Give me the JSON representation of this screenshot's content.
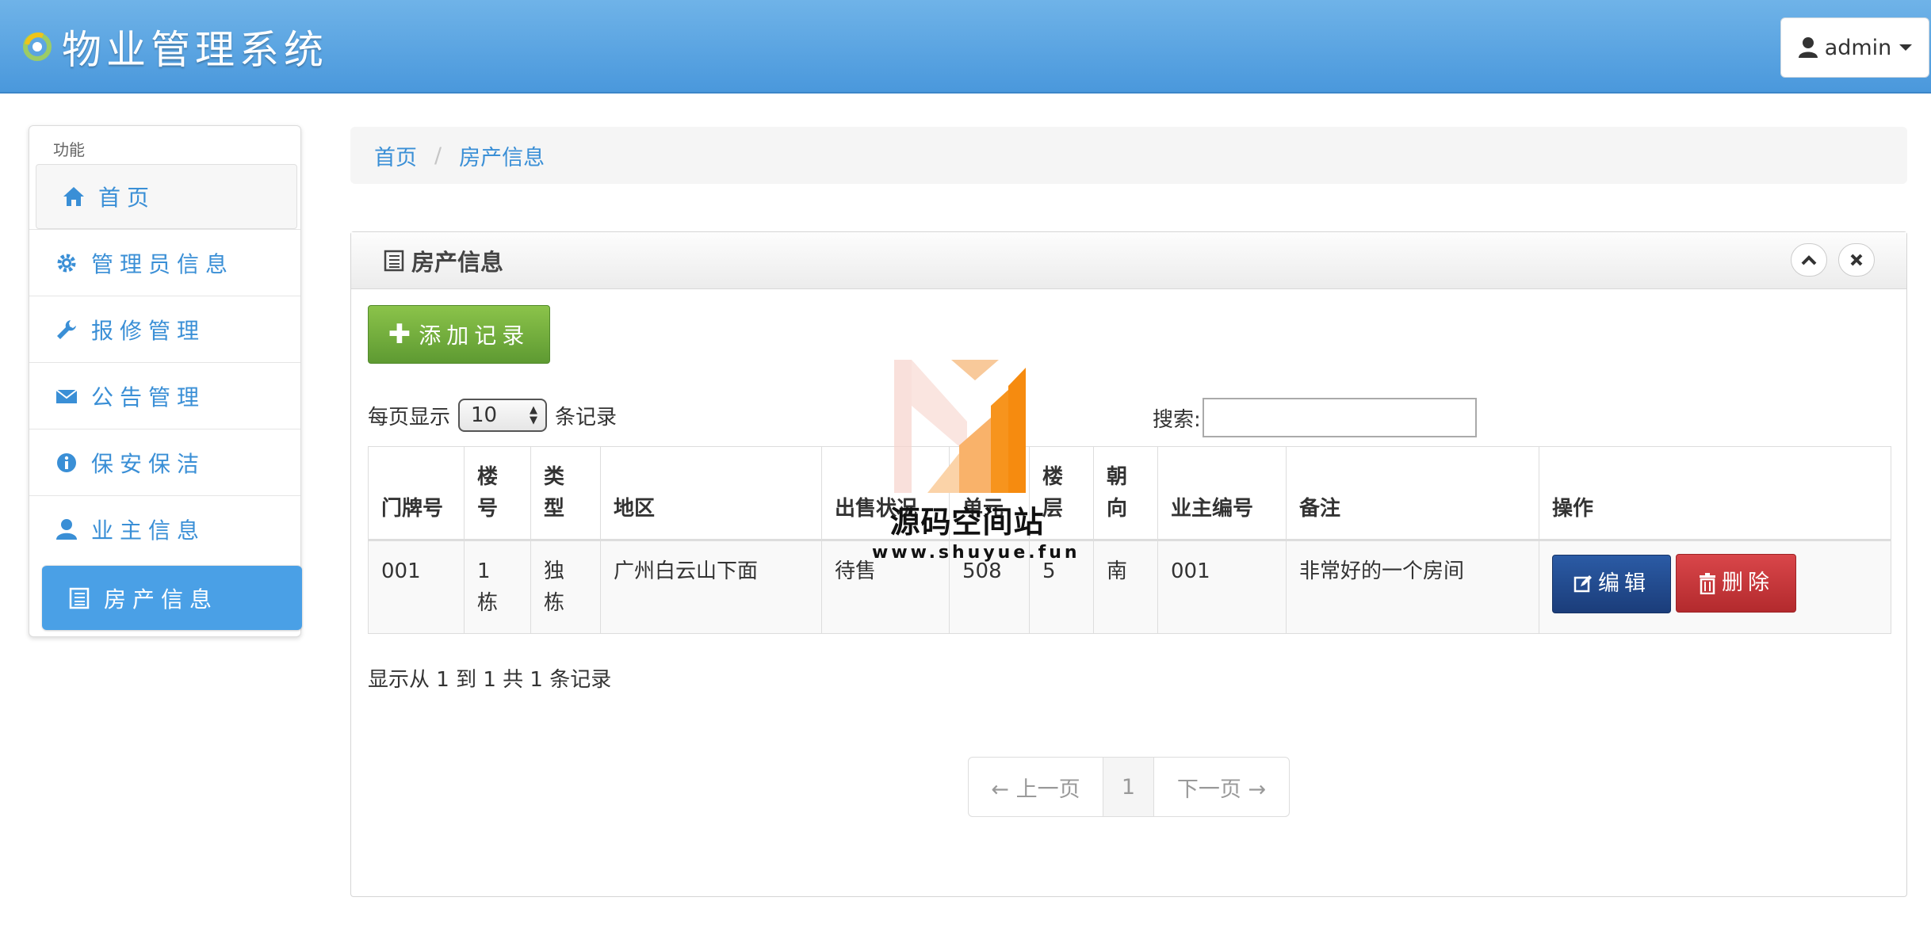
{
  "app": {
    "title": "物业管理系统",
    "user": "admin"
  },
  "sidebar": {
    "header": "功能",
    "items": [
      {
        "label": "首页",
        "icon": "home-icon"
      },
      {
        "label": "管理员信息",
        "icon": "gear-icon"
      },
      {
        "label": "报修管理",
        "icon": "wrench-icon"
      },
      {
        "label": "公告管理",
        "icon": "envelope-icon"
      },
      {
        "label": "保安保洁",
        "icon": "info-icon"
      },
      {
        "label": "业主信息",
        "icon": "user-icon"
      },
      {
        "label": "房产信息",
        "icon": "list-icon",
        "active": true
      }
    ]
  },
  "breadcrumb": {
    "home": "首页",
    "current": "房产信息"
  },
  "panel": {
    "title": "房产信息",
    "add_label": "添加记录",
    "length": {
      "prefix": "每页显示",
      "value": "10",
      "suffix": "条记录"
    },
    "search_label": "搜索:",
    "search_value": "",
    "info": "显示从 1 到 1 共 1 条记录"
  },
  "table": {
    "headers": [
      "门牌号",
      "楼号",
      "类型",
      "地区",
      "出售状况",
      "单元",
      "楼层",
      "朝向",
      "业主编号",
      "备注",
      "操作"
    ],
    "rows": [
      {
        "door": "001",
        "building": "1栋",
        "type": "独栋",
        "area": "广州白云山下面",
        "status": "待售",
        "unit": "508",
        "floor": "5",
        "orientation": "南",
        "owner_id": "001",
        "remark": "非常好的一个房间"
      }
    ],
    "edit_label": "编辑",
    "delete_label": "删除"
  },
  "pager": {
    "prev": "← 上一页",
    "page": "1",
    "next": "下一页 →"
  },
  "watermark": {
    "title": "源码空间站",
    "url": "www.shuyue.fun"
  },
  "colors": {
    "navbar": "#4a98dc",
    "accent": "#3a8fd6",
    "success": "#5e9a32",
    "edit": "#1b3d7a",
    "danger": "#b32a2d"
  }
}
